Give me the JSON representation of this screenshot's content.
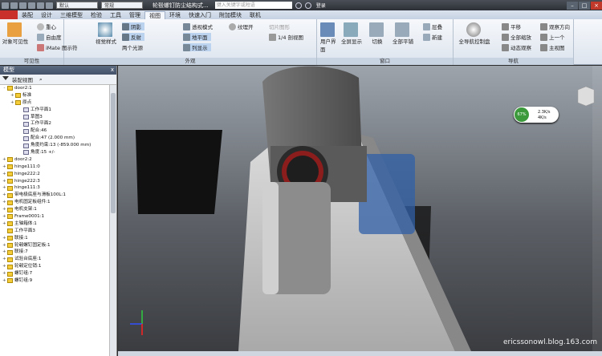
{
  "titlebar": {
    "project_combo": "默认",
    "material_combo": "常规",
    "title": "轮毂螺钉防尘结构式...",
    "search_placeholder": "键入关键字或短语",
    "user": "登录"
  },
  "tabs": [
    "装配",
    "设计",
    "三维模型",
    "检验",
    "工具",
    "管理",
    "视图",
    "环境",
    "快速入门",
    "附加模块",
    "联机"
  ],
  "active_tab": "视图",
  "ribbon": {
    "visibility": {
      "label": "可见性",
      "big_button": "对象可见性",
      "items": [
        "重心",
        "自由度",
        "iMate 图示符"
      ]
    },
    "appearance": {
      "label": "外观",
      "big_button": "视觉样式",
      "items": [
        "阴影",
        "反射",
        "两个光源",
        "透视模式",
        "地平面",
        "列显示",
        "纹理开",
        "1/4 剖视图",
        "切片图形"
      ]
    },
    "windows": {
      "label": "窗口",
      "buttons": [
        "用户界面",
        "全屏显示",
        "切换",
        "全部平铺",
        "层叠",
        "新建"
      ]
    },
    "navigate": {
      "label": "导航",
      "buttons": [
        "全导航控制盘",
        "平移",
        "全部缩放",
        "动态观察",
        "观察方向",
        "上一个",
        "主视图"
      ]
    }
  },
  "browser": {
    "title": "模型",
    "close": "x",
    "toolbar_label": "装配视图",
    "tree": [
      {
        "label": "door2:1",
        "exp": "-",
        "indent": 0
      },
      {
        "label": "标准",
        "exp": "+",
        "indent": 1
      },
      {
        "label": "原点",
        "exp": "+",
        "indent": 1
      },
      {
        "label": "工作平面1",
        "exp": "",
        "indent": 2
      },
      {
        "label": "草图3",
        "exp": "",
        "indent": 2
      },
      {
        "label": "工作平面2",
        "exp": "",
        "indent": 2
      },
      {
        "label": "配合:46",
        "exp": "",
        "indent": 2
      },
      {
        "label": "配合:47 (2.000 mm)",
        "exp": "",
        "indent": 2
      },
      {
        "label": "角度约束:13 (-859.000 mm)",
        "exp": "",
        "indent": 2
      },
      {
        "label": "角度:15 +/-",
        "exp": "",
        "indent": 2
      },
      {
        "label": "door2:2",
        "exp": "+",
        "indent": 0
      },
      {
        "label": "hinge111:0",
        "exp": "+",
        "indent": 0
      },
      {
        "label": "hinge222:2",
        "exp": "+",
        "indent": 0
      },
      {
        "label": "hinge222:3",
        "exp": "+",
        "indent": 0
      },
      {
        "label": "hinge111:3",
        "exp": "+",
        "indent": 0
      },
      {
        "label": "带电极底座与滑板100L:1",
        "exp": "+",
        "indent": 0
      },
      {
        "label": "电机固定板组件:1",
        "exp": "+",
        "indent": 0
      },
      {
        "label": "电机支架:1",
        "exp": "+",
        "indent": 0
      },
      {
        "label": "Frame0001:1",
        "exp": "+",
        "indent": 0
      },
      {
        "label": "主轴箱体:1",
        "exp": "+",
        "indent": 0
      },
      {
        "label": "工作平面3",
        "exp": "",
        "indent": 0
      },
      {
        "label": "联接:1",
        "exp": "+",
        "indent": 0
      },
      {
        "label": "轮毂螺钉固定板:1",
        "exp": "+",
        "indent": 0
      },
      {
        "label": "联接:7",
        "exp": "+",
        "indent": 0
      },
      {
        "label": "试验台底座:1",
        "exp": "+",
        "indent": 0
      },
      {
        "label": "轮毂定位销:1",
        "exp": "+",
        "indent": 0
      },
      {
        "label": "螺钉组:7",
        "exp": "+",
        "indent": 0
      },
      {
        "label": "螺钉组:9",
        "exp": "+",
        "indent": 0
      }
    ]
  },
  "perf": {
    "percent": "67%",
    "up": "2.3K/s",
    "down": "4K/s"
  },
  "watermark": "ericssonowl.blog.163.com"
}
